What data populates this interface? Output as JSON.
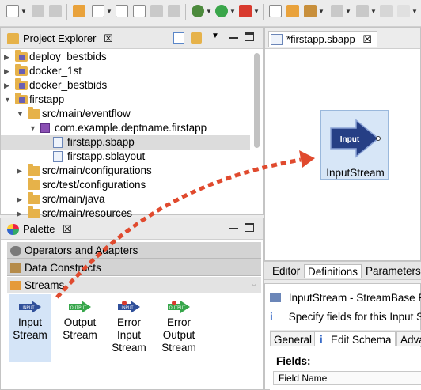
{
  "toolbar": {
    "icons": [
      "new-icon",
      "save-icon",
      "save-all-icon",
      "new-project-icon",
      "new-file-icon",
      "new-folder-icon",
      "open-type-icon",
      "build-icon",
      "debug-icon",
      "run-icon",
      "stop-icon",
      "open-task-icon",
      "open-folder-icon",
      "edit-icon",
      "next-annotation-icon",
      "prev-annotation-icon",
      "back-icon",
      "forward-icon"
    ]
  },
  "project_explorer": {
    "title": "Project Explorer",
    "close": "☒",
    "tree": [
      {
        "label": "deploy_bestbids",
        "depth": 0,
        "twisty": "▶",
        "type": "project"
      },
      {
        "label": "docker_1st",
        "depth": 0,
        "twisty": "▶",
        "type": "project"
      },
      {
        "label": "docker_bestbids",
        "depth": 0,
        "twisty": "▶",
        "type": "project"
      },
      {
        "label": "firstapp",
        "depth": 0,
        "twisty": "▼",
        "type": "project"
      },
      {
        "label": "src/main/eventflow",
        "depth": 1,
        "twisty": "▼",
        "type": "folder"
      },
      {
        "label": "com.example.deptname.firstapp",
        "depth": 2,
        "twisty": "▼",
        "type": "package"
      },
      {
        "label": "firstapp.sbapp",
        "depth": 3,
        "twisty": "",
        "type": "file",
        "selected": true
      },
      {
        "label": "firstapp.sblayout",
        "depth": 3,
        "twisty": "",
        "type": "file"
      },
      {
        "label": "src/main/configurations",
        "depth": 1,
        "twisty": "▶",
        "type": "folder"
      },
      {
        "label": "src/test/configurations",
        "depth": 1,
        "twisty": "",
        "type": "folder"
      },
      {
        "label": "src/main/java",
        "depth": 1,
        "twisty": "▶",
        "type": "folder"
      },
      {
        "label": "src/main/resources",
        "depth": 1,
        "twisty": "▶",
        "type": "folder"
      }
    ]
  },
  "palette": {
    "title": "Palette",
    "close": "☒",
    "drawers": [
      "Operators and Adapters",
      "Data Constructs",
      "Streams"
    ],
    "items": [
      {
        "line1": "Input",
        "line2": "Stream",
        "line3": "",
        "icon_text": "INPUT",
        "color": "#2f4f9a"
      },
      {
        "line1": "Output",
        "line2": "Stream",
        "line3": "",
        "icon_text": "OUTPUT",
        "color": "#36a64a"
      },
      {
        "line1": "Error",
        "line2": "Input",
        "line3": "Stream",
        "icon_text": "INPUT",
        "color": "#2f4f9a"
      },
      {
        "line1": "Error",
        "line2": "Output",
        "line3": "Stream",
        "icon_text": "OUTPUT",
        "color": "#36a64a"
      }
    ]
  },
  "editor": {
    "tab": "*firstapp.sbapp",
    "close": "☒",
    "component": {
      "icon_text": "Input",
      "label": "InputStream"
    },
    "tabs": [
      "Editor",
      "Definitions",
      "Parameters"
    ]
  },
  "properties": {
    "title": "InputStream - StreamBase P",
    "info": "Specify fields for this Input S",
    "tabs": [
      "General",
      "Edit Schema",
      "Adva"
    ],
    "fields_title": "Fields:",
    "column_header": "Field Name"
  },
  "colors": {
    "drag_arrow": "#e04a2e",
    "selected_item": "#d4e4f7"
  }
}
